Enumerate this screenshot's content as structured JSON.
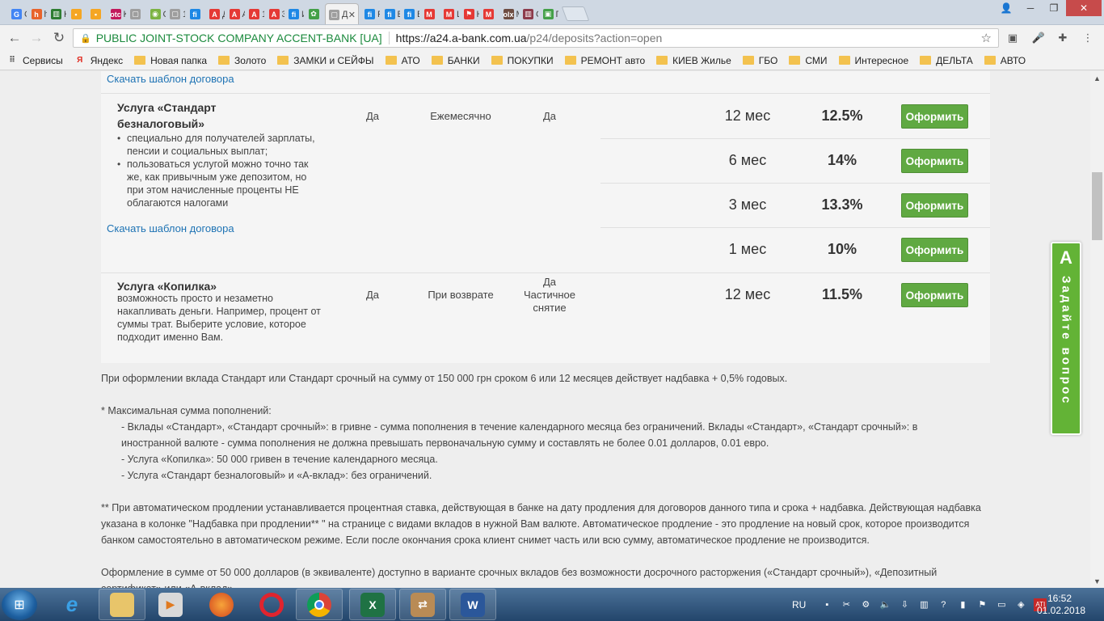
{
  "browser": {
    "tabs": [
      {
        "label": "G c",
        "favicon": "G",
        "color": "#4285f4"
      },
      {
        "label": "hel",
        "favicon": "h",
        "color": "#e8632b"
      },
      {
        "label": "K",
        "favicon": "▥",
        "color": "#2e7d32"
      },
      {
        "label": "",
        "favicon": "▪",
        "color": "#f5a623"
      },
      {
        "label": "",
        "favicon": "▪",
        "color": "#f5a623"
      },
      {
        "label": "K",
        "favicon": "otc",
        "color": "#c2185b"
      },
      {
        "label": "",
        "favicon": "▢",
        "color": "#9e9e9e"
      },
      {
        "label": "C",
        "favicon": "◉",
        "color": "#7cb342"
      },
      {
        "label": "1",
        "favicon": "▢",
        "color": "#9e9e9e"
      },
      {
        "label": "",
        "favicon": "fi",
        "color": "#1e88e5"
      },
      {
        "label": "Д",
        "favicon": "A",
        "color": "#e53935"
      },
      {
        "label": "A",
        "favicon": "A",
        "color": "#e53935"
      },
      {
        "label": "1",
        "favicon": "A",
        "color": "#e53935"
      },
      {
        "label": "3",
        "favicon": "A",
        "color": "#e53935"
      },
      {
        "label": "И",
        "favicon": "fi",
        "color": "#1e88e5"
      },
      {
        "label": "",
        "favicon": "✿",
        "color": "#43a047"
      },
      {
        "label": "Д",
        "favicon": "▢",
        "color": "#9e9e9e"
      },
      {
        "label": "F",
        "favicon": "fi",
        "color": "#1e88e5"
      },
      {
        "label": "E",
        "favicon": "fi",
        "color": "#1e88e5"
      },
      {
        "label": "B",
        "favicon": "fi",
        "color": "#1e88e5"
      },
      {
        "label": "",
        "favicon": "M",
        "color": "#e53935"
      },
      {
        "label": "L",
        "favicon": "M",
        "color": "#e53935"
      },
      {
        "label": "H",
        "favicon": "⚑",
        "color": "#e53935"
      },
      {
        "label": "",
        "favicon": "M",
        "color": "#e53935"
      },
      {
        "label": "M",
        "favicon": "olx",
        "color": "#6d4c41"
      },
      {
        "label": "C",
        "favicon": "▥",
        "color": "#8d3b4b"
      },
      {
        "label": "Г",
        "favicon": "▣",
        "color": "#43a047"
      }
    ],
    "active_tab_label": "Д",
    "security_label": "PUBLIC JOINT-STOCK COMPANY  ACCENT-BANK [UA]",
    "url_host": "https://a24.a-bank.com.ua",
    "url_rest": "/p24/deposits?action=open",
    "bookmarks": [
      {
        "label": "Сервисы",
        "kind": "apps"
      },
      {
        "label": "Яндекс",
        "kind": "yandex"
      },
      {
        "label": "Новая папка",
        "kind": "folder"
      },
      {
        "label": "Золото",
        "kind": "folder"
      },
      {
        "label": "ЗАМКИ и СЕЙФЫ",
        "kind": "folder"
      },
      {
        "label": "АТО",
        "kind": "folder"
      },
      {
        "label": "БАНКИ",
        "kind": "folder"
      },
      {
        "label": "ПОКУПКИ",
        "kind": "folder"
      },
      {
        "label": "РЕМОНТ авто",
        "kind": "folder"
      },
      {
        "label": "КИЕВ Жилье",
        "kind": "folder"
      },
      {
        "label": "ГБО",
        "kind": "folder"
      },
      {
        "label": "СМИ",
        "kind": "folder"
      },
      {
        "label": "Интересное",
        "kind": "folder"
      },
      {
        "label": "ДЕЛЬТА",
        "kind": "folder"
      },
      {
        "label": "АВТО",
        "kind": "folder"
      }
    ]
  },
  "page": {
    "download_link_top": "Скачать шаблон договора",
    "service1": {
      "title": "Услуга «Стандарт безналоговый»",
      "bullets": [
        "специально для получателей зарплаты, пенсии и социальных выплат;",
        "пользоваться услугой можно точно так же, как привычным уже депозитом, но при этом начисленные проценты НЕ облагаются налогами"
      ],
      "download_link": "Скачать шаблон договора",
      "col1": "Да",
      "col2": "Ежемесячно",
      "col3": "Да",
      "terms": [
        {
          "term": "12 мес",
          "rate": "12.5%",
          "button": "Оформить"
        },
        {
          "term": "6 мес",
          "rate": "14%",
          "button": "Оформить"
        },
        {
          "term": "3 мес",
          "rate": "13.3%",
          "button": "Оформить"
        },
        {
          "term": "1 мес",
          "rate": "10%",
          "button": "Оформить"
        }
      ]
    },
    "service2": {
      "title": "Услуга «Копилка»",
      "description": "возможность просто и незаметно накапливать деньги. Например, процент от суммы трат. Выберите условие, которое подходит именно Вам.",
      "col1": "Да",
      "col2": "При возврате",
      "col3": "Да Частичное снятие",
      "term": "12 мес",
      "rate": "11.5%",
      "button": "Оформить"
    },
    "note1": "При оформлении вклада Стандарт или Стандарт срочный на сумму от 150 000 грн сроком 6 или 12 месяцев действует надбавка + 0,5% годовых.",
    "note2_title": "* Максимальная сумма пополнений:",
    "note2_items": [
      "- Вклады «Стандарт», «Стандарт срочный»: в гривне - сумма пополнения в течение календарного месяца без ограничений. Вклады «Стандарт», «Стандарт срочный»: в иностранной валюте - сумма пополнения не должна превышать первоначальную сумму и составлять не более 0.01 долларов, 0.01 евро.",
      "- Услуга «Копилка»: 50 000 гривен в течение календарного месяца.",
      "- Услуга «Стандарт безналоговый» и «А-вклад»: без ограничений."
    ],
    "note3": "** При автоматическом продлении устанавливается процентная ставка, действующая в банке на дату продления для договоров данного типа и срока + надбавка. Действующая надбавка указана в колонке \"Надбавка при продлении** \" на странице с видами вкладов в нужной Вам валюте. Автоматическое продление - это продление на новый срок, которое производится банком самостоятельно в автоматическом режиме. Если после окончания срока клиент снимет часть или всю сумму, автоматическое продление не производится.",
    "note4": "Оформление в сумме от 50 000 долларов (в эквиваленте) доступно в варианте срочных вкладов без возможности досрочного расторжения («Стандарт срочный»), «Депозитный сертификат» или «А-вклад».",
    "ask_letter": "A",
    "ask_label": "Задайте вопрос"
  },
  "taskbar": {
    "apps": [
      "explorer",
      "internet-explorer",
      "media-player",
      "firefox",
      "opera",
      "chrome",
      "excel",
      "network",
      "word"
    ],
    "language": "RU",
    "time": "16:52",
    "date": "01.02.2018"
  },
  "colors": {
    "accent_green": "#60a942",
    "link_blue": "#1e73b4",
    "ask_green": "#63b336"
  }
}
